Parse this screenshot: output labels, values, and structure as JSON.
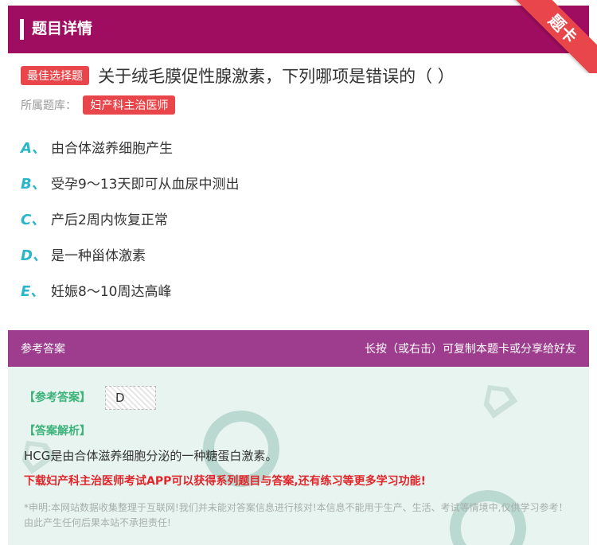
{
  "header": {
    "title": "题目详情",
    "ribbon": "题卡"
  },
  "question": {
    "badge": "最佳选择题",
    "text": "关于绒毛膜促性腺激素，下列哪项是错误的（ ）",
    "bank_label": "所属题库：",
    "bank": "妇产科主治医师"
  },
  "options": [
    {
      "letter": "A、",
      "text": "由合体滋养细胞产生"
    },
    {
      "letter": "B、",
      "text": "受孕9～13天即可从血尿中测出"
    },
    {
      "letter": "C、",
      "text": "产后2周内恢复正常"
    },
    {
      "letter": "D、",
      "text": "是一种甾体激素"
    },
    {
      "letter": "E、",
      "text": "妊娠8～10周达高峰"
    }
  ],
  "answer_header": {
    "left": "参考答案",
    "right": "长按（或右击）可复制本题卡或分享给好友"
  },
  "answer": {
    "answer_label": "【参考答案】",
    "answer_value": "D",
    "analysis_label": "【答案解析】",
    "analysis_text": "HCG是由合体滋养细胞分泌的一种糖蛋白激素。",
    "promo": "下载妇产科主治医师考试APP可以获得系列题目与答案,还有练习等更多学习功能!",
    "disclaimer": "*申明:本网站数据收集整理于互联网!我们并未能对答案信息进行核对!本信息不能用于生产、生活、考试等情境中,仅供学习参考！由此产生任何后果本站不承担责任!"
  },
  "colors": {
    "header": "#9e0d5f",
    "answer_header": "#9e3d8d",
    "accent": "#e8464a",
    "option_letter": "#29b6c8",
    "panel": "#e8f4f0"
  }
}
